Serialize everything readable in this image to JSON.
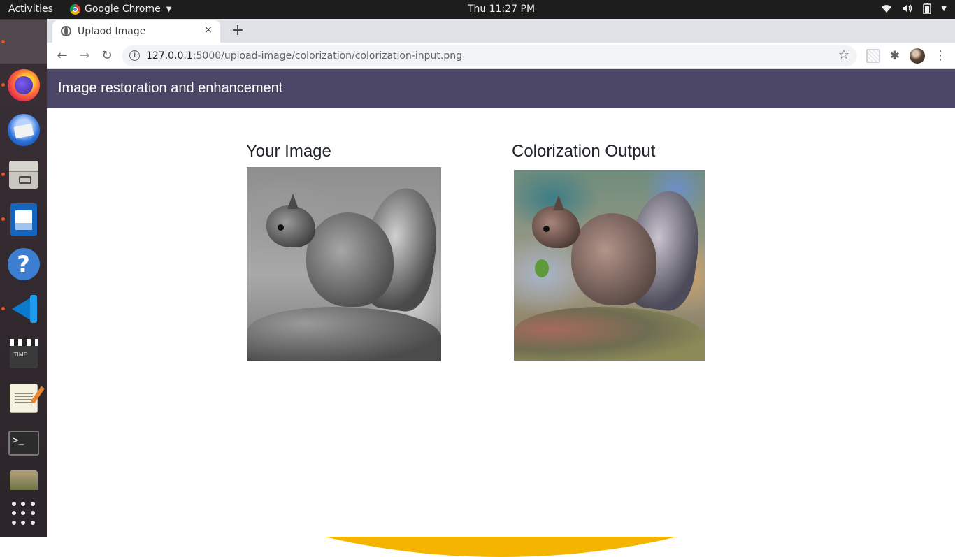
{
  "system": {
    "activities": "Activities",
    "app_name": "Google Chrome",
    "clock": "Thu 11:27 PM",
    "tray_icons": [
      "wifi-icon",
      "volume-icon",
      "battery-icon",
      "system-menu-caret"
    ]
  },
  "dock": {
    "items": [
      {
        "name": "chrome-icon",
        "active": true,
        "running": true
      },
      {
        "name": "firefox-icon",
        "running": true
      },
      {
        "name": "thunderbird-icon",
        "running": false
      },
      {
        "name": "files-icon",
        "running": true
      },
      {
        "name": "libreoffice-writer-icon",
        "running": true
      },
      {
        "name": "help-icon",
        "running": false
      },
      {
        "name": "vscode-icon",
        "running": true
      },
      {
        "name": "video-editor-icon",
        "running": false
      },
      {
        "name": "text-editor-icon",
        "running": false
      },
      {
        "name": "terminal-icon",
        "running": false
      },
      {
        "name": "photos-icon",
        "running": false
      }
    ],
    "help_glyph": "?"
  },
  "browser": {
    "tab_title": "Uplaod Image",
    "tab_close": "×",
    "new_tab": "+",
    "url_host": "127.0.0.1",
    "url_rest": ":5000/upload-image/colorization/colorization-input.png",
    "back": "←",
    "forward": "→",
    "reload": "↻",
    "star": "☆",
    "info": "i",
    "puzzle": "✱",
    "menu": "⋮"
  },
  "page": {
    "brand": "Image restoration and enhancement",
    "left_title": "Your Image",
    "right_title": "Colorization Output"
  },
  "colors": {
    "navbar": "#4b4666",
    "dock": "#2e2a2d",
    "running_dot": "#e95420"
  }
}
